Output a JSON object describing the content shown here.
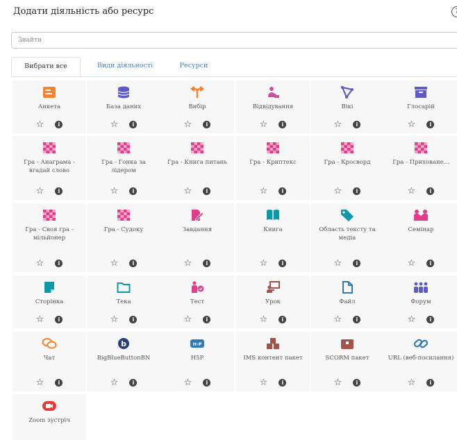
{
  "modal": {
    "title": "Додати діяльність або ресурс",
    "help": "?"
  },
  "search": {
    "placeholder": "Знайти"
  },
  "tabs": [
    "Вибрати все",
    "Види діяльності",
    "Ресурси"
  ],
  "colors": {
    "orange": "#f7822b",
    "purple": "#5d5cc4",
    "pink": "#e23d8a",
    "teal": "#0d98a7",
    "blue": "#2f7ab8",
    "brown": "#a2534a",
    "red": "#e23b3b"
  },
  "items": [
    {
      "label": "Анкета",
      "icon": "feedback-icon",
      "color": "#f7822b"
    },
    {
      "label": "База даних",
      "icon": "database-icon",
      "color": "#5d5cc4"
    },
    {
      "label": "Вибір",
      "icon": "choice-icon",
      "color": "#f7822b"
    },
    {
      "label": "Відвідування",
      "icon": "attendance-icon",
      "color": "#cf4ea0"
    },
    {
      "label": "Вікі",
      "icon": "wiki-icon",
      "color": "#5d5cc4"
    },
    {
      "label": "Глосарій",
      "icon": "glossary-icon",
      "color": "#5d5cc4"
    },
    {
      "label": "Гра - Анаграма - вгадай слово",
      "icon": "game-icon",
      "color": "#e23d8a"
    },
    {
      "label": "Гра - Гонка за лідером",
      "icon": "game-icon",
      "color": "#e23d8a"
    },
    {
      "label": "Гра - Книга питань",
      "icon": "game-icon",
      "color": "#e23d8a"
    },
    {
      "label": "Гра - Криптекс",
      "icon": "game-icon",
      "color": "#e23d8a"
    },
    {
      "label": "Гра - Кросворд",
      "icon": "game-icon",
      "color": "#e23d8a"
    },
    {
      "label": "Гра - Приховане...",
      "icon": "game-icon",
      "color": "#e23d8a"
    },
    {
      "label": "Гра - Своя гра - мільйонер",
      "icon": "game-icon",
      "color": "#e23d8a"
    },
    {
      "label": "Гра - Судоку",
      "icon": "game-icon",
      "color": "#e23d8a"
    },
    {
      "label": "Завдання",
      "icon": "assignment-icon",
      "color": "#e23d8a"
    },
    {
      "label": "Книга",
      "icon": "book-icon",
      "color": "#0d98a7"
    },
    {
      "label": "Область тексту та медіа",
      "icon": "label-icon",
      "color": "#0d98a7"
    },
    {
      "label": "Семінар",
      "icon": "workshop-icon",
      "color": "#e23d8a"
    },
    {
      "label": "Сторінка",
      "icon": "page-icon",
      "color": "#0d98a7"
    },
    {
      "label": "Тека",
      "icon": "folder-icon",
      "color": "#0d98a7"
    },
    {
      "label": "Тест",
      "icon": "quiz-icon",
      "color": "#e23d8a"
    },
    {
      "label": "Урок",
      "icon": "lesson-icon",
      "color": "#a2534a"
    },
    {
      "label": "Файл",
      "icon": "file-icon",
      "color": "#2f7ab8"
    },
    {
      "label": "Форум",
      "icon": "forum-icon",
      "color": "#5d5cc4"
    },
    {
      "label": "Чат",
      "icon": "chat-icon",
      "color": "#f7822b"
    },
    {
      "label": "BigBlueButtonBN",
      "icon": "bigbluebutton-icon",
      "color": "#2f7ab8"
    },
    {
      "label": "H5P",
      "icon": "h5p-icon",
      "color": "#2f7ab8"
    },
    {
      "label": "IMS контент пакет",
      "icon": "ims-icon",
      "color": "#a2534a"
    },
    {
      "label": "SCORM пакет",
      "icon": "scorm-icon",
      "color": "#a2534a"
    },
    {
      "label": "URL (веб-посилання)",
      "icon": "url-icon",
      "color": "#2f7ab8"
    },
    {
      "label": "Zoom зустріч",
      "icon": "zoom-icon",
      "color": "#e23b3b"
    }
  ],
  "action_icons": {
    "star": "☆",
    "info": "i"
  }
}
